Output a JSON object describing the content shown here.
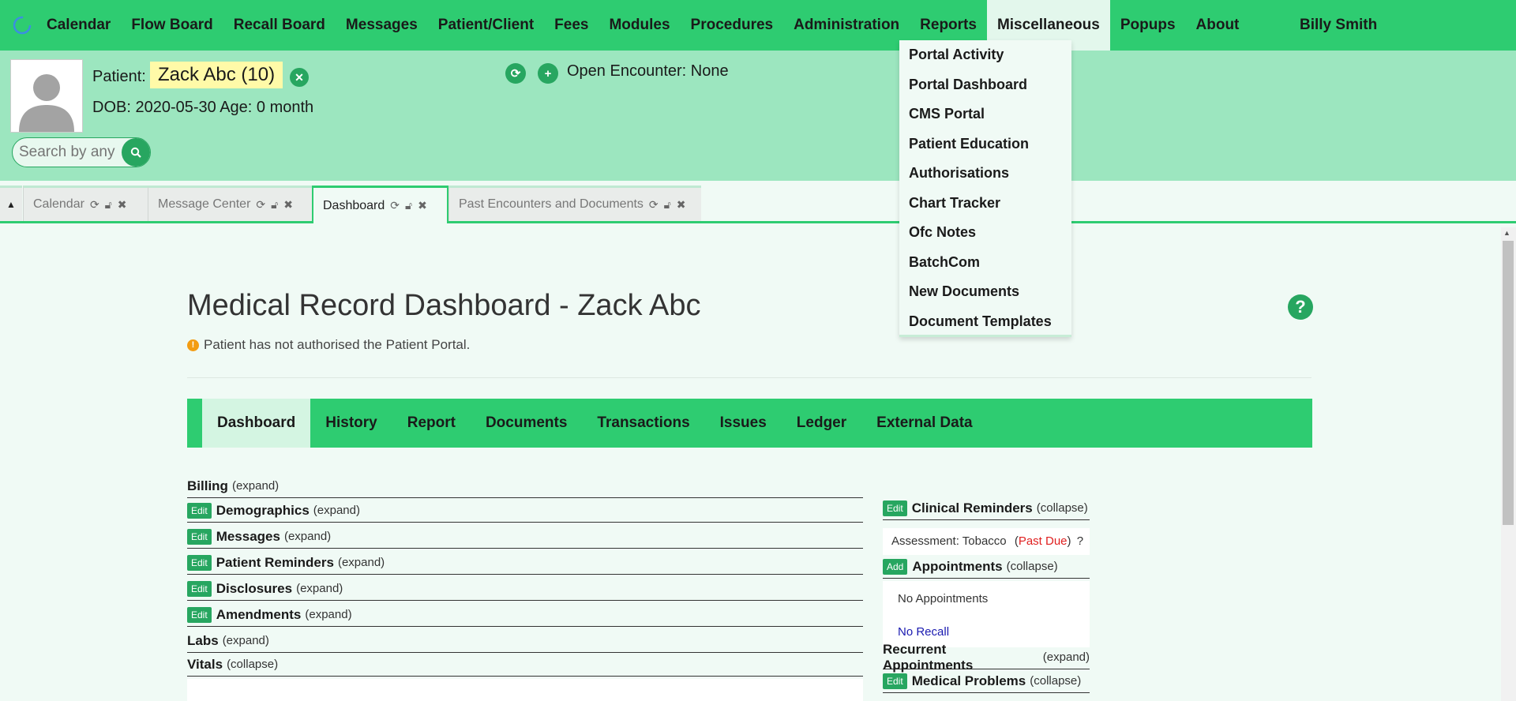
{
  "nav": {
    "items": [
      "Calendar",
      "Flow Board",
      "Recall Board",
      "Messages",
      "Patient/Client",
      "Fees",
      "Modules",
      "Procedures",
      "Administration",
      "Reports",
      "Miscellaneous",
      "Popups",
      "About"
    ],
    "active": "Miscellaneous",
    "user": "Billy Smith"
  },
  "patient": {
    "label": "Patient:",
    "name": "Zack Abc (10)",
    "dob_line": "DOB: 2020-05-30 Age: 0 month",
    "search_placeholder": "Search by any",
    "encounter": "Open Encounter: None"
  },
  "tabs": [
    {
      "label": "Calendar"
    },
    {
      "label": "Message Center"
    },
    {
      "label": "Dashboard"
    },
    {
      "label": "Past Encounters and Documents"
    }
  ],
  "main": {
    "title": "Medical Record Dashboard - Zack Abc",
    "warning": "Patient has not authorised the Patient Portal.",
    "help": "?"
  },
  "dashboard_tabs": [
    "Dashboard",
    "History",
    "Report",
    "Documents",
    "Transactions",
    "Issues",
    "Ledger",
    "External Data"
  ],
  "left_sections": [
    {
      "title": "Billing",
      "toggle": "(expand)",
      "edit": ""
    },
    {
      "title": "Demographics",
      "toggle": "(expand)",
      "edit": "Edit"
    },
    {
      "title": "Messages",
      "toggle": "(expand)",
      "edit": "Edit"
    },
    {
      "title": "Patient Reminders",
      "toggle": "(expand)",
      "edit": "Edit"
    },
    {
      "title": "Disclosures",
      "toggle": "(expand)",
      "edit": "Edit"
    },
    {
      "title": "Amendments",
      "toggle": "(expand)",
      "edit": "Edit"
    },
    {
      "title": "Labs",
      "toggle": "(expand)",
      "edit": ""
    },
    {
      "title": "Vitals",
      "toggle": "(collapse)",
      "edit": ""
    }
  ],
  "right": {
    "clinical_reminders": {
      "edit": "Edit",
      "title": "Clinical Reminders",
      "toggle": "(collapse)"
    },
    "reminder_item": {
      "text": "Assessment: Tobacco",
      "status": "(Past Due)",
      "status_open": "(",
      "status_label": "Past Due",
      "status_close": ")",
      "help": "?"
    },
    "appointments": {
      "add": "Add",
      "title": "Appointments",
      "toggle": "(collapse)"
    },
    "no_appointments": "No Appointments",
    "no_recall": "No Recall",
    "recurrent": {
      "title": "Recurrent Appointments",
      "toggle": "(expand)"
    },
    "medical_problems": {
      "edit": "Edit",
      "title": "Medical Problems",
      "toggle": "(collapse)"
    }
  },
  "dropdown": {
    "items": [
      "Portal Activity",
      "Portal Dashboard",
      "CMS Portal",
      "Patient Education",
      "Authorisations",
      "Chart Tracker",
      "Ofc Notes",
      "BatchCom",
      "New Documents",
      "Document Templates"
    ]
  },
  "colors": {
    "primary": "#2ecc71",
    "header_bg": "#9ce6bf",
    "button": "#27a660",
    "highlight": "#fffaa8",
    "past_due": "#e02020",
    "link": "#1a1ab0"
  }
}
